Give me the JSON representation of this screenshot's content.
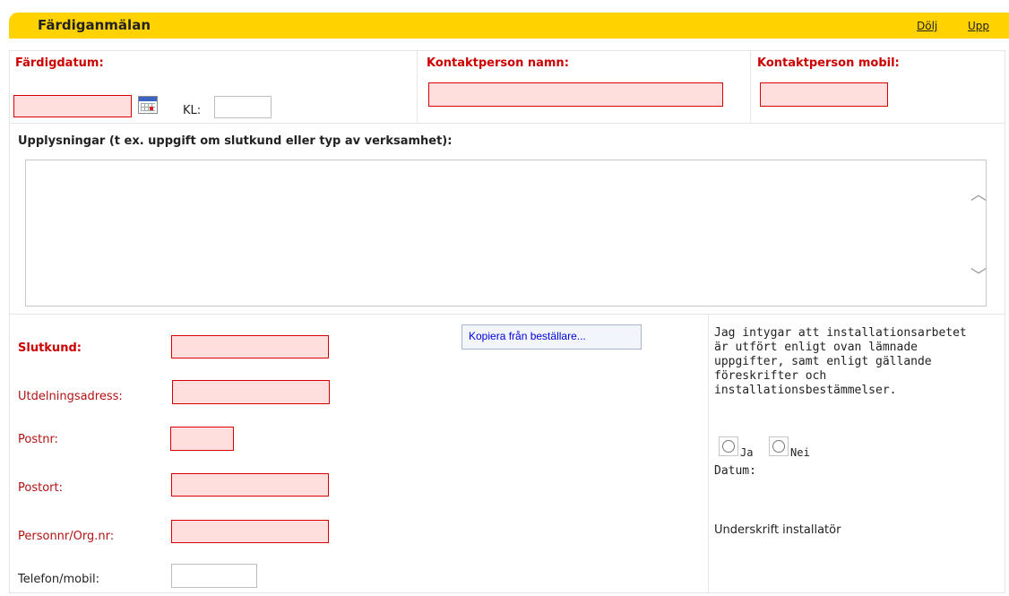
{
  "header": {
    "title": "Färdiganmälan",
    "hide_label": "Dölj",
    "up_label": "Upp"
  },
  "completion": {
    "date_label": "Färdigdatum:",
    "time_label": "KL:",
    "date_value": "",
    "time_value": "",
    "contact_name_label": "Kontaktperson namn:",
    "contact_name_value": "",
    "contact_mobile_label": "Kontaktperson mobil:",
    "contact_mobile_value": ""
  },
  "notes": {
    "label": "Upplysningar (t ex. uppgift om slutkund eller typ av verksamhet):",
    "value": ""
  },
  "customer": {
    "end_customer_label": "Slutkund:",
    "address_label": "Utdelningsadress:",
    "postal_code_label": "Postnr:",
    "city_label": "Postort:",
    "id_label": "Personnr/Org.nr:",
    "phone_label": "Telefon/mobil:"
  },
  "copy_button_label": "Kopiera från beställare...",
  "certification": {
    "lines": [
      "Jag intygar att installationsarbetet",
      "är utfört enligt ovan lämnade",
      "uppgifter, samt enligt gällande",
      "föreskrifter och",
      "installationsbestämmelser."
    ],
    "yes_label": "Ja",
    "no_label": "Nei",
    "date_label": "Datum:",
    "signature_label": "Underskrift installatör"
  },
  "icons": {
    "calendar": "calendar-icon",
    "scroll_up": "chevron-up-icon",
    "scroll_down": "chevron-down-icon"
  },
  "colors": {
    "header": "#ffd200",
    "required_fill": "#ffdede",
    "required_border": "#d90000",
    "required_label": "#cc0000"
  }
}
